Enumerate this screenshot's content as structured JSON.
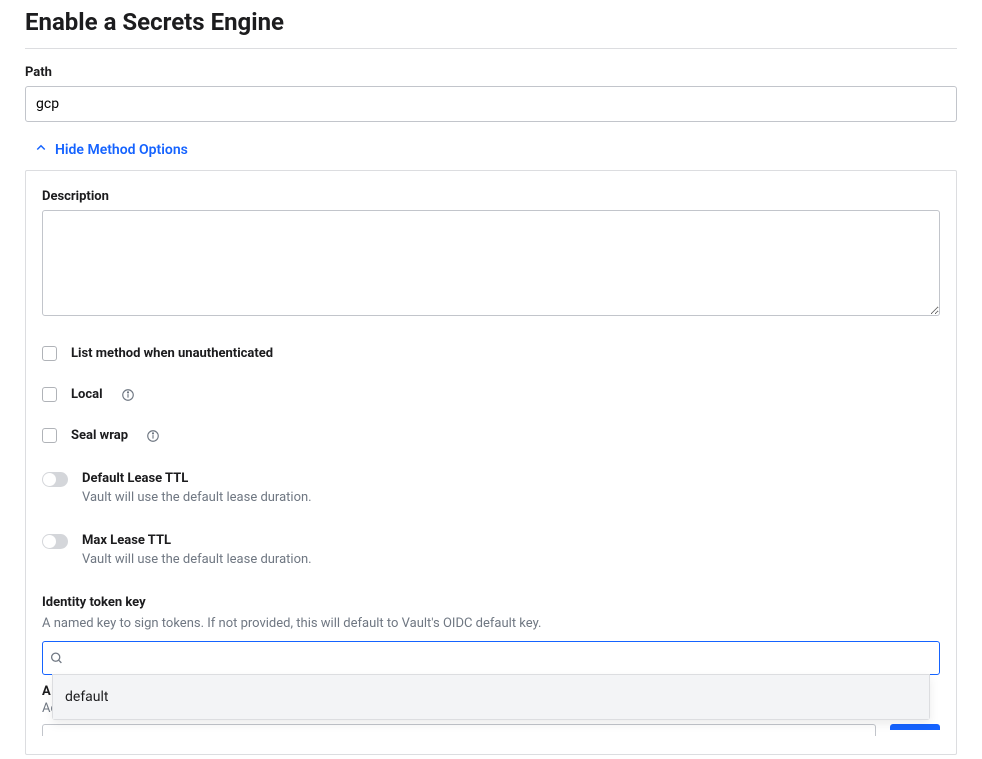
{
  "title": "Enable a Secrets Engine",
  "path": {
    "label": "Path",
    "value": "gcp"
  },
  "toggleOptions": "Hide Method Options",
  "description": {
    "label": "Description",
    "value": ""
  },
  "checkboxes": {
    "listUnauth": "List method when unauthenticated",
    "local": "Local",
    "sealWrap": "Seal wrap"
  },
  "toggles": {
    "defaultLease": {
      "label": "Default Lease TTL",
      "help": "Vault will use the default lease duration."
    },
    "maxLease": {
      "label": "Max Lease TTL",
      "help": "Vault will use the default lease duration."
    }
  },
  "identityKey": {
    "label": "Identity token key",
    "help": "A named key to sign tokens. If not provided, this will default to Vault's OIDC default key.",
    "searchValue": "",
    "options": [
      "default"
    ]
  },
  "belowField": {
    "labelPartial": "A",
    "help": "Add one item per row."
  }
}
